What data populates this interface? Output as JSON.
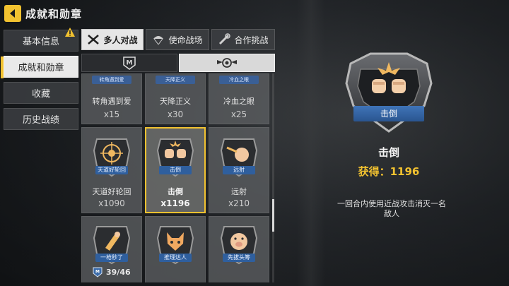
{
  "header": {
    "title": "成就和勋章"
  },
  "sidebar": {
    "items": [
      {
        "label": "基本信息",
        "alert": true
      },
      {
        "label": "成就和勋章",
        "active": true
      },
      {
        "label": "收藏"
      },
      {
        "label": "历史战绩"
      }
    ]
  },
  "tabs": [
    {
      "label": "多人对战",
      "active": true,
      "icon": "crossed-guns-icon"
    },
    {
      "label": "使命战场",
      "icon": "parachute-icon"
    },
    {
      "label": "合作挑战",
      "icon": "hand-weapon-icon"
    }
  ],
  "subtabs": [
    {
      "icon": "m-emblem-icon",
      "active": false
    },
    {
      "icon": "wings-emblem-icon",
      "active": true
    }
  ],
  "medals": [
    {
      "mini_label": "转角遇到爱",
      "name": "转角遇到爱",
      "count": "x15"
    },
    {
      "mini_label": "天降正义",
      "name": "天降正义",
      "count": "x30"
    },
    {
      "mini_label": "冷血之眼",
      "name": "冷血之眼",
      "count": "x25"
    },
    {
      "ribbon": "天道好轮回",
      "name": "天道好轮回",
      "count": "x1090",
      "icon": "target-icon"
    },
    {
      "ribbon": "击倒",
      "name": "击倒",
      "count": "x1196",
      "icon": "fists-icon",
      "selected": true
    },
    {
      "ribbon": "远射",
      "name": "远射",
      "count": "x210",
      "icon": "long-shot-icon"
    },
    {
      "ribbon": "一枪秒了",
      "icon": "bullet-icon"
    },
    {
      "ribbon": "推理达人",
      "icon": "fox-icon"
    },
    {
      "ribbon": "先拔头筹",
      "icon": "pig-icon"
    }
  ],
  "progress": {
    "text": "39/46",
    "icon": "medal-count-icon"
  },
  "detail": {
    "ribbon": "击倒",
    "title": "击倒",
    "obtained": "获得：1196",
    "description": "一回合内使用近战攻击消灭一名敌人"
  },
  "colors": {
    "accent": "#f2c230",
    "ribbon": "#2f5f9e",
    "selected_border": "#f2c230"
  }
}
